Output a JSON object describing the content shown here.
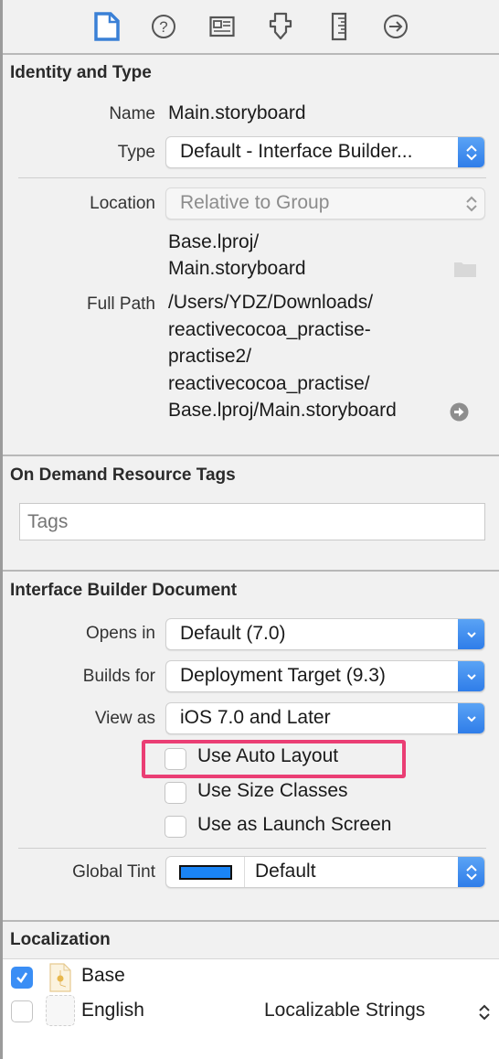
{
  "toolbar": {
    "icons": [
      {
        "name": "file-inspector-icon",
        "active": true
      },
      {
        "name": "quick-help-icon",
        "active": false
      },
      {
        "name": "identity-inspector-icon",
        "active": false
      },
      {
        "name": "attributes-inspector-icon",
        "active": false
      },
      {
        "name": "size-inspector-icon",
        "active": false
      },
      {
        "name": "connections-inspector-icon",
        "active": false
      }
    ],
    "accent_color": "#3a80d6"
  },
  "identity": {
    "title": "Identity and Type",
    "name_label": "Name",
    "name_value": "Main.storyboard",
    "type_label": "Type",
    "type_value": "Default - Interface Builder...",
    "location_label": "Location",
    "location_value": "Relative to Group",
    "location_path_line1": "Base.lproj/",
    "location_path_line2": "Main.storyboard",
    "full_path_label": "Full Path",
    "full_path_lines": [
      "/Users/YDZ/Downloads/",
      "reactivecocoa_practise-",
      "practise2/",
      "reactivecocoa_practise/",
      "Base.lproj/Main.storyboard"
    ]
  },
  "odr": {
    "title": "On Demand Resource Tags",
    "tags_placeholder": "Tags",
    "tags_value": ""
  },
  "ibdoc": {
    "title": "Interface Builder Document",
    "opens_in_label": "Opens in",
    "opens_in_value": "Default (7.0)",
    "builds_for_label": "Builds for",
    "builds_for_value": "Deployment Target (9.3)",
    "view_as_label": "View as",
    "view_as_value": "iOS 7.0 and Later",
    "checkboxes": [
      {
        "label": "Use Auto Layout",
        "checked": false,
        "highlighted": true
      },
      {
        "label": "Use Size Classes",
        "checked": false
      },
      {
        "label": "Use as Launch Screen",
        "checked": false
      }
    ],
    "global_tint_label": "Global Tint",
    "global_tint_value": "Default",
    "global_tint_color": "#1a84f5",
    "highlight_color": "#ea3e74"
  },
  "localization": {
    "title": "Localization",
    "items": [
      {
        "label": "Base",
        "checked": true,
        "type": ""
      },
      {
        "label": "English",
        "checked": false,
        "type": "Localizable Strings"
      }
    ]
  }
}
